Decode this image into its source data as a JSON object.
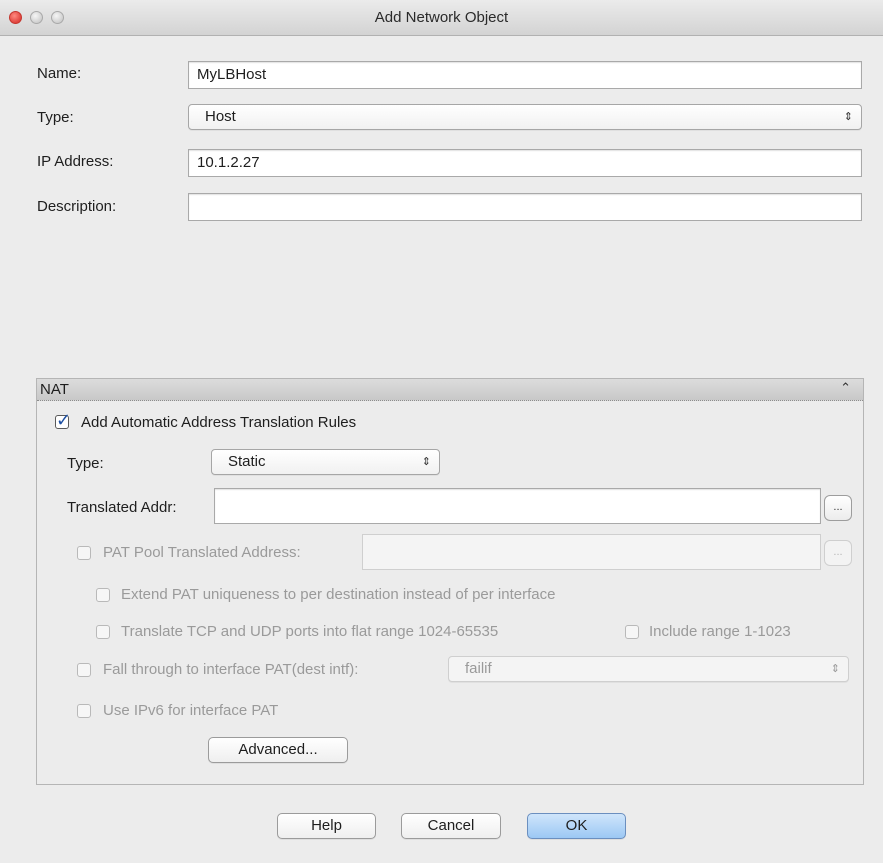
{
  "window": {
    "title": "Add Network Object"
  },
  "form": {
    "name_label": "Name:",
    "name_value": "MyLBHost",
    "type_label": "Type:",
    "type_value": "Host",
    "ip_label": "IP Address:",
    "ip_value": "10.1.2.27",
    "description_label": "Description:",
    "description_value": ""
  },
  "nat": {
    "title": "NAT",
    "auto_rules_label": "Add Automatic Address Translation Rules",
    "auto_rules_checked": true,
    "type_label": "Type:",
    "type_value": "Static",
    "translated_addr_label": "Translated Addr:",
    "translated_addr_value": "",
    "browse_label": "...",
    "pat_pool_label": "PAT Pool Translated Address:",
    "pat_pool_value": "",
    "extend_pat_label": "Extend PAT uniqueness to per destination instead of per interface",
    "translate_ports_label": "Translate TCP and UDP ports into flat range 1024-65535",
    "include_range_label": "Include range 1-1023",
    "fall_through_label": "Fall through to interface PAT(dest intf):",
    "fall_through_value": "failif",
    "ipv6_label": "Use IPv6 for interface PAT",
    "advanced_label": "Advanced..."
  },
  "footer": {
    "help_label": "Help",
    "cancel_label": "Cancel",
    "ok_label": "OK"
  },
  "icons": {
    "select_arrows": "⇕",
    "collapse": "double-chevron-up-icon",
    "checkmark": "checkmark-icon"
  },
  "colors": {
    "primary_button": "#9cc8f4",
    "checkmark": "#1d4fa3",
    "close_button": "#e0443e"
  }
}
